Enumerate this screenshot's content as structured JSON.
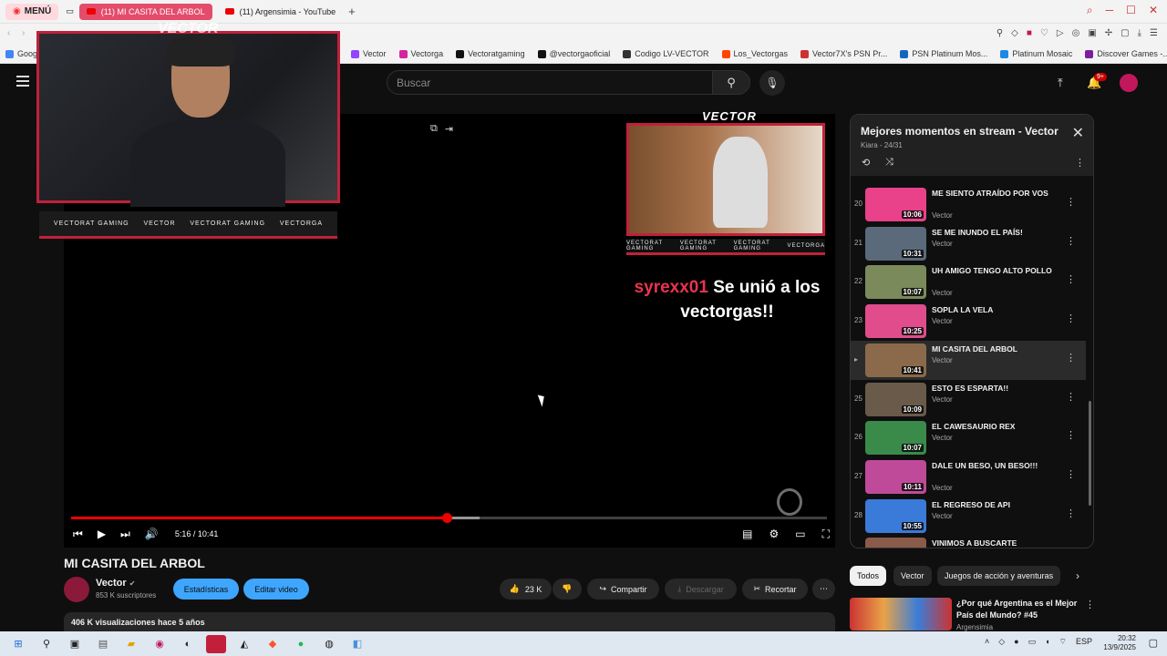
{
  "browser": {
    "menu_label": "MENÚ",
    "tabs": [
      {
        "label": "(11) MI CASITA DEL ARBOL",
        "active": true
      },
      {
        "label": "(11) Argensimia - YouTube",
        "active": false
      }
    ],
    "new_tab": "+",
    "bookmarks": [
      "Goog",
      "Vector",
      "Vectorga",
      "Vectoratgaming",
      "@vectorgaoficial",
      "Codigo LV-VECTOR",
      "Los_Vectorgas",
      "Vector7X's PSN Pr...",
      "PSN Platinum Mos...",
      "Platinum Mosaic",
      "Discover Games -..."
    ]
  },
  "header": {
    "search_placeholder": "Buscar",
    "notif_count": "9+"
  },
  "video": {
    "overlay_brand": "VECTOR",
    "strip_items": [
      "VECTORAT GAMING",
      "VECTOR",
      "VECTORAT GAMING",
      "VECTORGA"
    ],
    "cam2_strip_items": [
      "VECTORAT GAMING",
      "VECTORAT GAMING",
      "VECTORAT GAMING",
      "VECTORGA"
    ],
    "alert_user": "syrexx01",
    "alert_text": "Se unió a los vectorgas!!",
    "time": "5:16 / 10:41",
    "progress_fraction": 0.497,
    "buffered_fraction": 0.54
  },
  "meta": {
    "title": "MI CASITA DEL ARBOL",
    "channel": "Vector",
    "subscribers": "853 K suscriptores",
    "stats_label": "Estadísticas",
    "edit_label": "Editar video",
    "likes": "23 K",
    "share_label": "Compartir",
    "download_label": "Descargar",
    "clip_label": "Recortar",
    "views_line": "406 K visualizaciones  hace 5 años"
  },
  "playlist": {
    "title": "Mejores momentos en stream - Vector",
    "subtitle": "Kiara - 24/31",
    "items": [
      {
        "index": "20",
        "title": "ME SIENTO ATRAÍDO POR VOS",
        "channel": "Vector",
        "duration": "10:06",
        "color": "#e9418a"
      },
      {
        "index": "21",
        "title": "SE ME INUNDO EL PAÍS!",
        "channel": "Vector",
        "duration": "10:31",
        "color": "#5a6a7a"
      },
      {
        "index": "22",
        "title": "UH AMIGO TENGO ALTO POLLO",
        "channel": "Vector",
        "duration": "10:07",
        "color": "#7a8a5a"
      },
      {
        "index": "23",
        "title": "SOPLA LA VELA",
        "channel": "Vector",
        "duration": "10:25",
        "color": "#e04c8c"
      },
      {
        "index": "▸",
        "title": "MI CASITA DEL ARBOL",
        "channel": "Vector",
        "duration": "10:41",
        "color": "#8a6a4a",
        "current": true
      },
      {
        "index": "25",
        "title": "ESTO ES ESPARTA!!",
        "channel": "Vector",
        "duration": "10:09",
        "color": "#6a5a4a"
      },
      {
        "index": "26",
        "title": "EL CAWESAURIO REX",
        "channel": "Vector",
        "duration": "10:07",
        "color": "#3a8a4a"
      },
      {
        "index": "27",
        "title": "DALE UN BESO, UN BESO!!!",
        "channel": "Vector",
        "duration": "10:11",
        "color": "#c04a9a"
      },
      {
        "index": "28",
        "title": "EL REGRESO DE API",
        "channel": "Vector",
        "duration": "10:55",
        "color": "#3a7ad8"
      },
      {
        "index": "",
        "title": "VINIMOS A BUSCARTE",
        "channel": "",
        "duration": "",
        "color": "#8a5a4a"
      }
    ]
  },
  "chips": [
    "Todos",
    "Vector",
    "Juegos de acción y aventuras"
  ],
  "recommendation": {
    "title": "¿Por qué Argentina es el Mejor País del Mundo? #45",
    "channel": "Argensimia"
  },
  "taskbar": {
    "time": "20:32",
    "date": "13/9/2025",
    "lang": "ESP"
  }
}
